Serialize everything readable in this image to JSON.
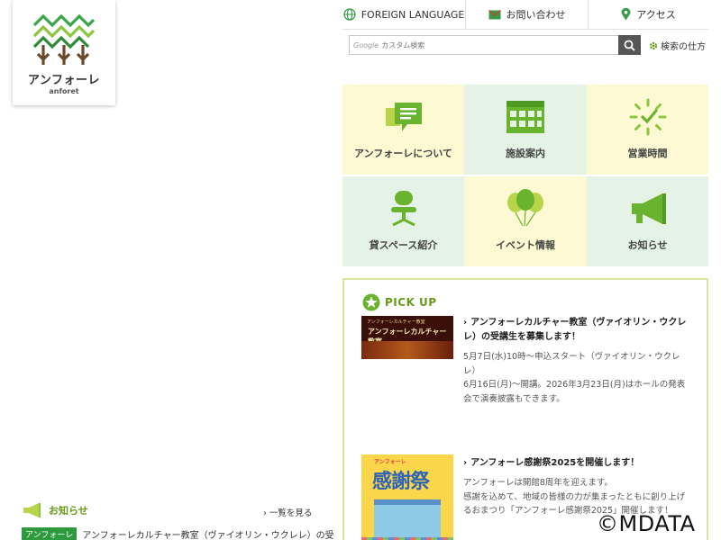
{
  "logo": {
    "name": "アンフォーレ",
    "sub": "anforet"
  },
  "topnav": {
    "foreign": "FOREIGN LANGUAGE",
    "contact": "お問い合わせ",
    "access": "アクセス"
  },
  "search": {
    "google_label": "Google",
    "placeholder": "カスタム検索",
    "help": "検索の仕方"
  },
  "tiles": [
    {
      "label": "アンフォーレについて",
      "icon": "speech-document-icon"
    },
    {
      "label": "施設案内",
      "icon": "building-icon"
    },
    {
      "label": "営業時間",
      "icon": "clock-icon"
    },
    {
      "label": "貸スペース紹介",
      "icon": "chair-icon"
    },
    {
      "label": "イベント情報",
      "icon": "balloons-icon"
    },
    {
      "label": "お知らせ",
      "icon": "megaphone-icon"
    }
  ],
  "pickup": {
    "title": "PICK UP",
    "items": [
      {
        "title": "アンフォーレカルチャー教室（ヴァイオリン・ウクレレ）の受講生を募集します！",
        "lines": [
          "5月7日(水)10時～申込スタート（ヴァイオリン・ウクレレ）",
          "6月16日(月)～開講。2026年3月23日(月)はホールの発表会で演奏披露もできます。"
        ],
        "thumb_small": "アンフォーレカルチャー教室",
        "thumb_big": "アンフォーレカルチャー教室"
      },
      {
        "title": "アンフォーレ感謝祭2025を開催します！",
        "lines": [
          "アンフォーレは開館8周年を迎えます。",
          "感謝を込めて、地域の皆様の力が集まったともに創り上げるおまつり「アンフォーレ感謝祭2025」開催します！"
        ],
        "thumb_small": "アンフォーレ",
        "thumb_big": "感謝祭"
      }
    ]
  },
  "news": {
    "title": "お知らせ",
    "more": "一覧を見る",
    "row": {
      "tag": "アンフォーレ",
      "text": "アンフォーレカルチャー教室（ヴァイオリン・ウクレレ）の受"
    }
  },
  "watermark": "©MDATA"
}
